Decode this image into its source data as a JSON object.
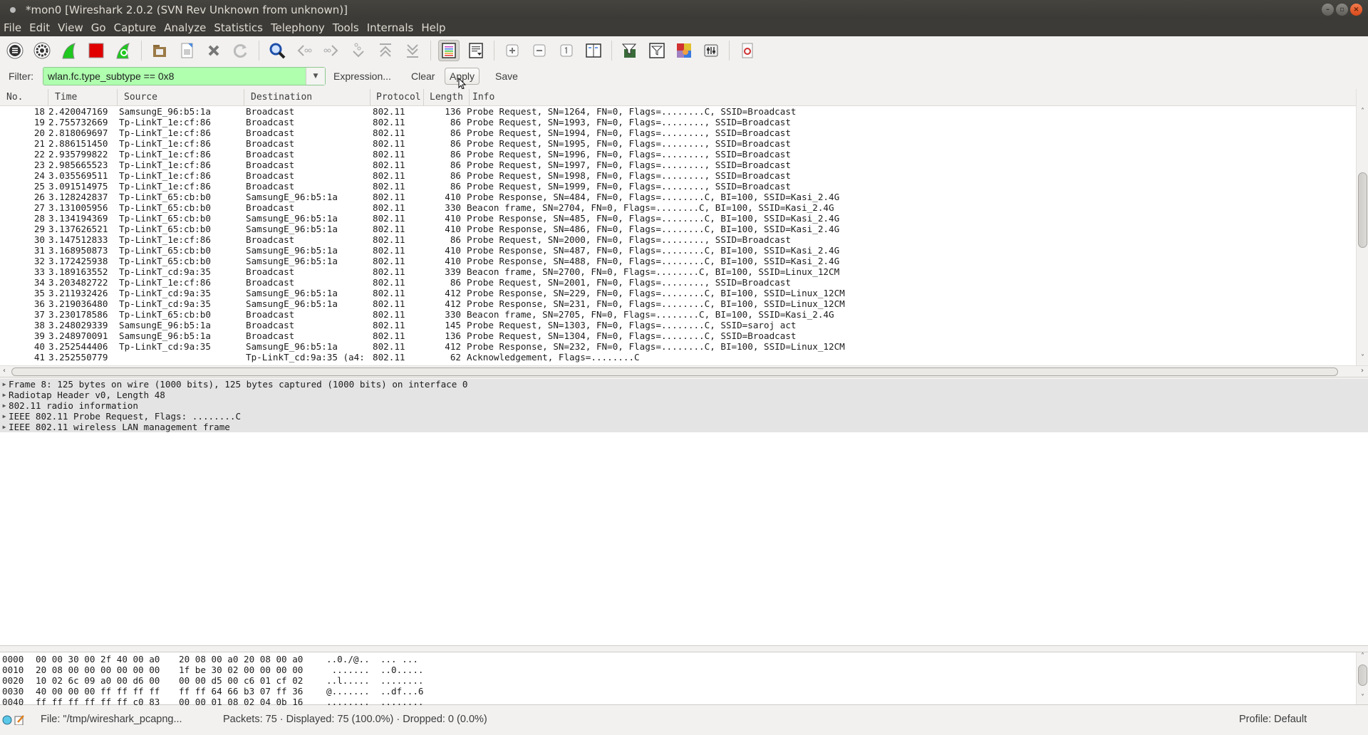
{
  "window": {
    "title": "*mon0 [Wireshark 2.0.2 (SVN Rev Unknown from unknown)]",
    "buttons": [
      "minimize",
      "maximize",
      "close"
    ]
  },
  "menu": [
    "File",
    "Edit",
    "View",
    "Go",
    "Capture",
    "Analyze",
    "Statistics",
    "Telephony",
    "Tools",
    "Internals",
    "Help"
  ],
  "toolbar": {
    "groups": [
      [
        "interfaces-icon",
        "capture-options-icon",
        "start-capture-icon",
        "stop-capture-icon",
        "restart-capture-icon"
      ],
      [
        "open-file-icon",
        "save-file-icon",
        "close-file-icon",
        "reload-icon"
      ],
      [
        "find-packet-icon",
        "go-back-icon",
        "go-forward-icon",
        "go-to-packet-icon",
        "go-first-icon",
        "go-last-icon"
      ],
      [
        "colorize-icon",
        "autoscroll-icon"
      ],
      [
        "zoom-in-icon",
        "zoom-out-icon",
        "normal-size-icon",
        "resize-columns-icon"
      ],
      [
        "capture-filters-icon",
        "display-filters-icon",
        "coloring-rules-icon",
        "preferences-icon"
      ],
      [
        "help-icon"
      ]
    ]
  },
  "filter": {
    "label": "Filter:",
    "value": "wlan.fc.type_subtype == 0x8",
    "valid_color": "#afffaf",
    "expression_label": "Expression...",
    "clear_label": "Clear",
    "apply_label": "Apply",
    "save_label": "Save"
  },
  "packet_list": {
    "columns": [
      "No.",
      "Time",
      "Source",
      "Destination",
      "Protocol",
      "Length",
      "Info"
    ],
    "rows": [
      [
        "18",
        "2.420047169",
        "SamsungE_96:b5:1a",
        "Broadcast",
        "802.11",
        "136",
        "Probe Request, SN=1264, FN=0, Flags=........C, SSID=Broadcast"
      ],
      [
        "19",
        "2.755732669",
        "Tp-LinkT_1e:cf:86",
        "Broadcast",
        "802.11",
        "86",
        "Probe Request, SN=1993, FN=0, Flags=........, SSID=Broadcast"
      ],
      [
        "20",
        "2.818069697",
        "Tp-LinkT_1e:cf:86",
        "Broadcast",
        "802.11",
        "86",
        "Probe Request, SN=1994, FN=0, Flags=........, SSID=Broadcast"
      ],
      [
        "21",
        "2.886151450",
        "Tp-LinkT_1e:cf:86",
        "Broadcast",
        "802.11",
        "86",
        "Probe Request, SN=1995, FN=0, Flags=........, SSID=Broadcast"
      ],
      [
        "22",
        "2.935799822",
        "Tp-LinkT_1e:cf:86",
        "Broadcast",
        "802.11",
        "86",
        "Probe Request, SN=1996, FN=0, Flags=........, SSID=Broadcast"
      ],
      [
        "23",
        "2.985665523",
        "Tp-LinkT_1e:cf:86",
        "Broadcast",
        "802.11",
        "86",
        "Probe Request, SN=1997, FN=0, Flags=........, SSID=Broadcast"
      ],
      [
        "24",
        "3.035569511",
        "Tp-LinkT_1e:cf:86",
        "Broadcast",
        "802.11",
        "86",
        "Probe Request, SN=1998, FN=0, Flags=........, SSID=Broadcast"
      ],
      [
        "25",
        "3.091514975",
        "Tp-LinkT_1e:cf:86",
        "Broadcast",
        "802.11",
        "86",
        "Probe Request, SN=1999, FN=0, Flags=........, SSID=Broadcast"
      ],
      [
        "26",
        "3.128242837",
        "Tp-LinkT_65:cb:b0",
        "SamsungE_96:b5:1a",
        "802.11",
        "410",
        "Probe Response, SN=484, FN=0, Flags=........C, BI=100, SSID=Kasi_2.4G"
      ],
      [
        "27",
        "3.131005956",
        "Tp-LinkT_65:cb:b0",
        "Broadcast",
        "802.11",
        "330",
        "Beacon frame, SN=2704, FN=0, Flags=........C, BI=100, SSID=Kasi_2.4G"
      ],
      [
        "28",
        "3.134194369",
        "Tp-LinkT_65:cb:b0",
        "SamsungE_96:b5:1a",
        "802.11",
        "410",
        "Probe Response, SN=485, FN=0, Flags=........C, BI=100, SSID=Kasi_2.4G"
      ],
      [
        "29",
        "3.137626521",
        "Tp-LinkT_65:cb:b0",
        "SamsungE_96:b5:1a",
        "802.11",
        "410",
        "Probe Response, SN=486, FN=0, Flags=........C, BI=100, SSID=Kasi_2.4G"
      ],
      [
        "30",
        "3.147512833",
        "Tp-LinkT_1e:cf:86",
        "Broadcast",
        "802.11",
        "86",
        "Probe Request, SN=2000, FN=0, Flags=........, SSID=Broadcast"
      ],
      [
        "31",
        "3.168950873",
        "Tp-LinkT_65:cb:b0",
        "SamsungE_96:b5:1a",
        "802.11",
        "410",
        "Probe Response, SN=487, FN=0, Flags=........C, BI=100, SSID=Kasi_2.4G"
      ],
      [
        "32",
        "3.172425938",
        "Tp-LinkT_65:cb:b0",
        "SamsungE_96:b5:1a",
        "802.11",
        "410",
        "Probe Response, SN=488, FN=0, Flags=........C, BI=100, SSID=Kasi_2.4G"
      ],
      [
        "33",
        "3.189163552",
        "Tp-LinkT_cd:9a:35",
        "Broadcast",
        "802.11",
        "339",
        "Beacon frame, SN=2700, FN=0, Flags=........C, BI=100, SSID=Linux_12CM"
      ],
      [
        "34",
        "3.203482722",
        "Tp-LinkT_1e:cf:86",
        "Broadcast",
        "802.11",
        "86",
        "Probe Request, SN=2001, FN=0, Flags=........, SSID=Broadcast"
      ],
      [
        "35",
        "3.211932426",
        "Tp-LinkT_cd:9a:35",
        "SamsungE_96:b5:1a",
        "802.11",
        "412",
        "Probe Response, SN=229, FN=0, Flags=........C, BI=100, SSID=Linux_12CM"
      ],
      [
        "36",
        "3.219036480",
        "Tp-LinkT_cd:9a:35",
        "SamsungE_96:b5:1a",
        "802.11",
        "412",
        "Probe Response, SN=231, FN=0, Flags=........C, BI=100, SSID=Linux_12CM"
      ],
      [
        "37",
        "3.230178586",
        "Tp-LinkT_65:cb:b0",
        "Broadcast",
        "802.11",
        "330",
        "Beacon frame, SN=2705, FN=0, Flags=........C, BI=100, SSID=Kasi_2.4G"
      ],
      [
        "38",
        "3.248029339",
        "SamsungE_96:b5:1a",
        "Broadcast",
        "802.11",
        "145",
        "Probe Request, SN=1303, FN=0, Flags=........C, SSID=saroj act"
      ],
      [
        "39",
        "3.248970091",
        "SamsungE_96:b5:1a",
        "Broadcast",
        "802.11",
        "136",
        "Probe Request, SN=1304, FN=0, Flags=........C, SSID=Broadcast"
      ],
      [
        "40",
        "3.252544406",
        "Tp-LinkT_cd:9a:35",
        "SamsungE_96:b5:1a",
        "802.11",
        "412",
        "Probe Response, SN=232, FN=0, Flags=........C, BI=100, SSID=Linux_12CM"
      ],
      [
        "41",
        "3.252550779",
        "",
        "Tp-LinkT_cd:9a:35 (a4:",
        "802.11",
        "62",
        "Acknowledgement, Flags=........C"
      ]
    ]
  },
  "details": [
    "Frame 8: 125 bytes on wire (1000 bits), 125 bytes captured (1000 bits) on interface 0",
    "Radiotap Header v0, Length 48",
    "802.11 radio information",
    "IEEE 802.11 Probe Request, Flags: ........C",
    "IEEE 802.11 wireless LAN management frame"
  ],
  "hex": [
    [
      "0000",
      "00 00 30 00 2f 40 00 a0",
      "20 08 00 a0 20 08 00 a0",
      "..0./@..  ... ..."
    ],
    [
      "0010",
      "20 08 00 00 00 00 00 00",
      "1f be 30 02 00 00 00 00",
      " .......  ..0....."
    ],
    [
      "0020",
      "10 02 6c 09 a0 00 d6 00",
      "00 00 d5 00 c6 01 cf 02",
      "..l.....  ........"
    ],
    [
      "0030",
      "40 00 00 00 ff ff ff ff",
      "ff ff 64 66 b3 07 ff 36",
      "@.......  ..df...6"
    ],
    [
      "0040",
      "ff ff ff ff ff ff c0 83",
      "00 00 01 08 02 04 0b 16",
      "........  ........"
    ]
  ],
  "status": {
    "file": "File: \"/tmp/wireshark_pcapng...",
    "packets": "Packets: 75 · Displayed: 75 (100.0%)  · Dropped: 0 (0.0%)",
    "profile": "Profile: Default"
  }
}
